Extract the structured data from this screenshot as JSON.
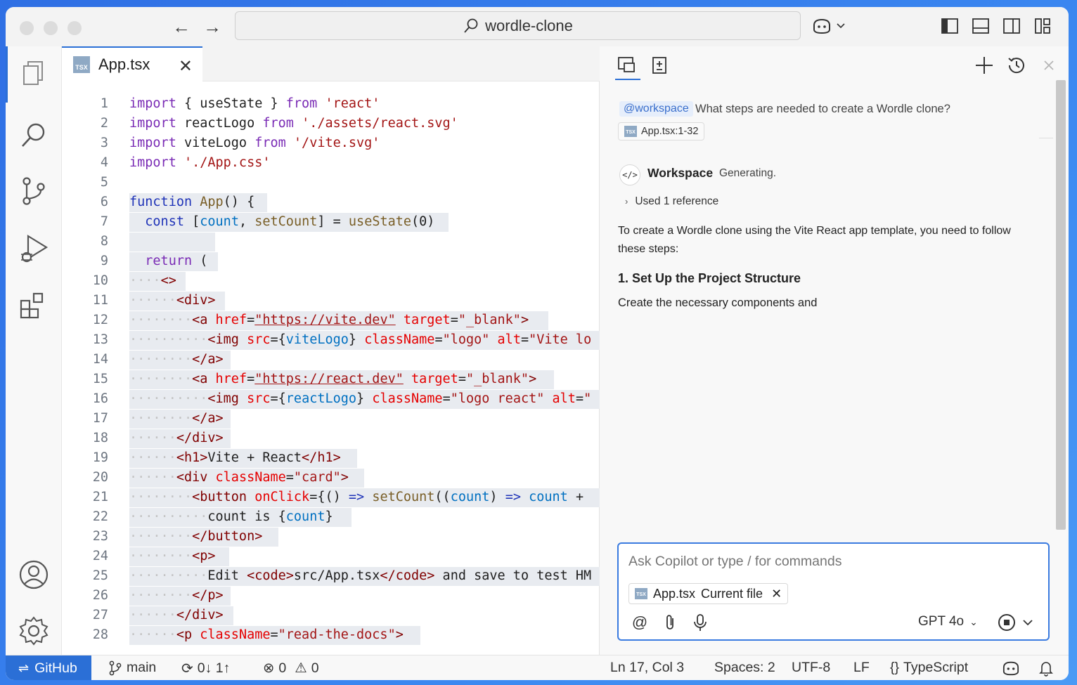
{
  "titlebar": {
    "search_text": "wordle-clone"
  },
  "editor": {
    "tab": {
      "label": "App.tsx",
      "badge": "TSX"
    },
    "line_numbers": [
      "1",
      "2",
      "3",
      "4",
      "5",
      "6",
      "7",
      "8",
      "9",
      "10",
      "11",
      "12",
      "13",
      "14",
      "15",
      "16",
      "17",
      "18",
      "19",
      "20",
      "21",
      "22",
      "23",
      "24",
      "25",
      "26",
      "27",
      "28"
    ],
    "code_lines": [
      "import { useState } from 'react'",
      "import reactLogo from './assets/react.svg'",
      "import viteLogo from '/vite.svg'",
      "import './App.css'",
      "",
      "function App() {",
      "  const [count, setCount] = useState(0)",
      "",
      "  return (",
      "    <>",
      "      <div>",
      "        <a href=\"https://vite.dev\" target=\"_blank\">",
      "          <img src={viteLogo} className=\"logo\" alt=\"Vite lo",
      "        </a>",
      "        <a href=\"https://react.dev\" target=\"_blank\">",
      "          <img src={reactLogo} className=\"logo react\" alt=\"",
      "        </a>",
      "      </div>",
      "      <h1>Vite + React</h1>",
      "      <div className=\"card\">",
      "        <button onClick={() => setCount((count) => count +",
      "          count is {count}",
      "        </button>",
      "        <p>",
      "          Edit <code>src/App.tsx</code> and save to test HM",
      "        </p>",
      "      </div>",
      "      <p className=\"read-the-docs\">"
    ]
  },
  "chat": {
    "mention": "@workspace",
    "question": "What steps are needed to create a Wordle clone?",
    "reference_chip": "App.tsx:1-32",
    "responder_name": "Workspace",
    "responder_status": "Generating.",
    "used_references": "Used 1 reference",
    "intro_paragraph": "To create a Wordle clone using the Vite React app template, you need to follow these steps:",
    "step_title": "1. Set Up the Project Structure",
    "step_text": "Create the necessary components and",
    "input": {
      "placeholder": "Ask Copilot or type / for commands",
      "file_chip_name": "App.tsx",
      "file_chip_suffix": "Current file",
      "model": "GPT 4o"
    }
  },
  "statusbar": {
    "remote": "GitHub",
    "branch": "main",
    "sync": "0↓ 1↑",
    "errors": "0",
    "warnings": "0",
    "cursor": "Ln 17, Col 3",
    "spaces": "Spaces: 2",
    "encoding": "UTF-8",
    "eol": "LF",
    "language": "TypeScript"
  },
  "colors": {
    "accent": "#2b6fd6",
    "keyword": "#7a2bb5",
    "string": "#a31515",
    "tag": "#800000",
    "attribute": "#e50000"
  }
}
